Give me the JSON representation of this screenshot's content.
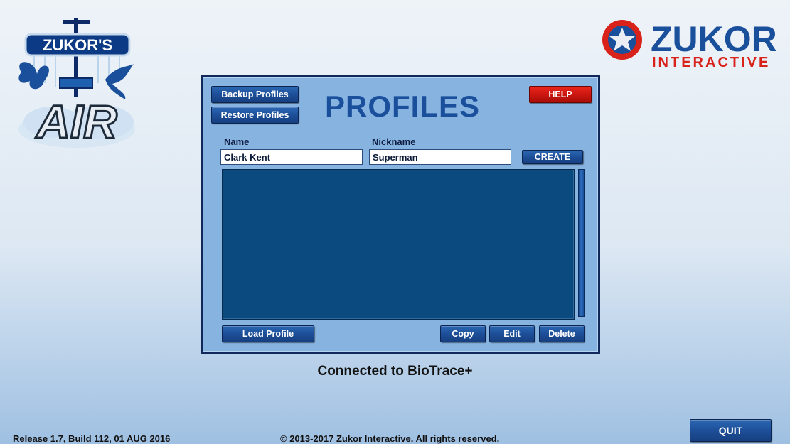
{
  "app": {
    "logo_text_top": "ZUKOR'S",
    "logo_text_main": "AIR",
    "brand_name": "ZUKOR",
    "brand_sub": "INTERACTIVE"
  },
  "panel": {
    "title": "PROFILES",
    "backup_label": "Backup Profiles",
    "restore_label": "Restore Profiles",
    "help_label": "HELP",
    "name_label": "Name",
    "nickname_label": "Nickname",
    "name_value": "Clark Kent",
    "nickname_value": "Superman",
    "create_label": "CREATE",
    "load_label": "Load Profile",
    "copy_label": "Copy",
    "edit_label": "Edit",
    "delete_label": "Delete",
    "profiles": []
  },
  "status": "Connected to BioTrace+",
  "footer": {
    "release": "Release 1.7, Build 112, 01 AUG 2016",
    "copyright": "© 2013-2017 Zukor Interactive. All rights reserved.",
    "quit_label": "QUIT"
  },
  "colors": {
    "accent": "#1d4f98",
    "help": "#cc1710",
    "list_bg": "#0b4a7e",
    "panel_bg": "#87b3e1"
  }
}
